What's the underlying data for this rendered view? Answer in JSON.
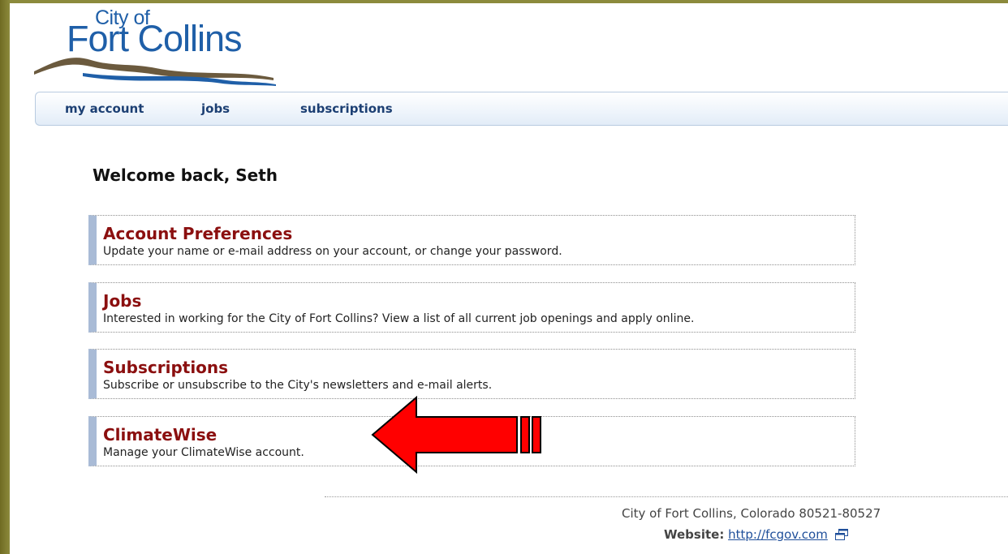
{
  "logo": {
    "line1": "City of",
    "line2": "Fort Collins"
  },
  "nav": {
    "items": [
      "my account",
      "jobs",
      "subscriptions"
    ]
  },
  "welcome": "Welcome back, Seth",
  "cards": [
    {
      "title": "Account Preferences",
      "description": "Update your name or e-mail address on your account, or change your password."
    },
    {
      "title": "Jobs",
      "description": "Interested in working for the City of Fort Collins? View a list of all current job openings and apply online."
    },
    {
      "title": "Subscriptions",
      "description": "Subscribe or unsubscribe to the City's newsletters and e-mail alerts."
    },
    {
      "title": "ClimateWise",
      "description": "Manage your ClimateWise account."
    }
  ],
  "footer": {
    "address": "City of Fort Collins, Colorado 80521-80527",
    "website_label": "Website:",
    "website_url": "http://fcgov.com"
  },
  "colors": {
    "frame": "#7d7a2e",
    "brand_blue": "#1f5fa8",
    "card_title": "#8b0f0f",
    "arrow": "#ff0000"
  },
  "icons": {
    "external_link": "external-window-icon",
    "annotation": "red-arrow-annotation"
  }
}
